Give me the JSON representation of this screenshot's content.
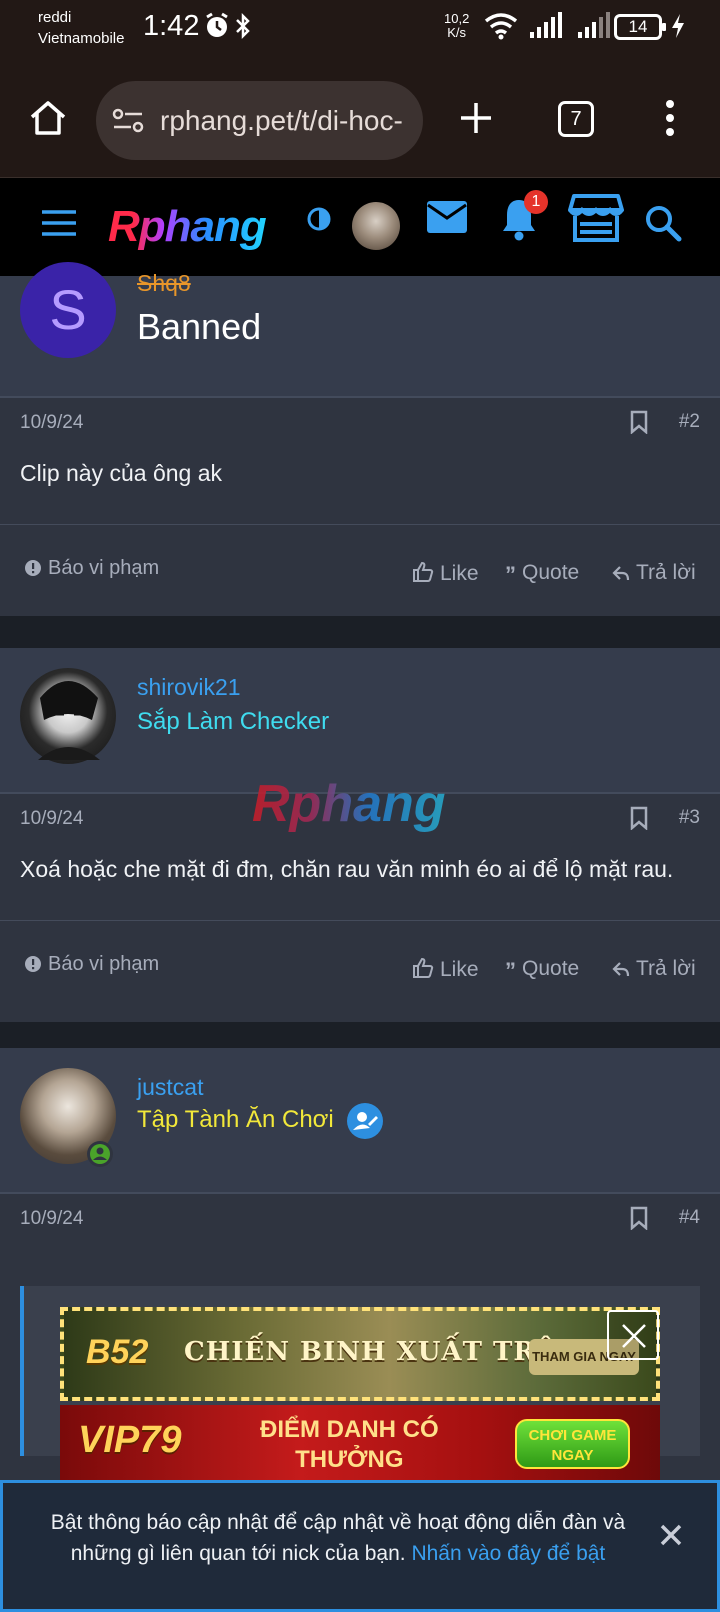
{
  "status": {
    "carrier_line1": "reddi",
    "carrier_line2": "Vietnamobile",
    "time": "1:42",
    "net_speed_value": "10,2",
    "net_speed_unit": "K/s",
    "battery": "14"
  },
  "browser": {
    "url": "rphang.pet/t/di-hoc-",
    "tab_count": "7"
  },
  "site": {
    "logo": "Rphang",
    "notification_count": "1",
    "watermark": "Rphang",
    "colors": {
      "accent": "#2d8fe0",
      "bg": "#1b1f26",
      "card": "#2f3440",
      "userrow": "#353c4c"
    }
  },
  "posts": [
    {
      "avatar_letter": "S",
      "username": "Shq8",
      "user_title": "Banned",
      "date": "10/9/24",
      "number": "#2",
      "text": "Clip này của ông ak",
      "report": "Báo vi phạm",
      "like": "Like",
      "quote": "Quote",
      "reply": "Trả lời"
    },
    {
      "username": "shirovik21",
      "user_title": "Sắp Làm Checker",
      "date": "10/9/24",
      "number": "#3",
      "text": "Xoá hoặc che mặt đi đm, chăn rau văn minh éo ai để lộ mặt rau.",
      "report": "Báo vi phạm",
      "like": "Like",
      "quote": "Quote",
      "reply": "Trả lời"
    },
    {
      "username": "justcat",
      "user_title": "Tập Tành Ăn Chơi",
      "date": "10/9/24",
      "number": "#4"
    }
  ],
  "ads": {
    "banner1_brand": "B52",
    "banner1_title": "CHIẾN BINH XUẤT TRẬN",
    "banner1_button": "THAM GIA NGAY",
    "banner2_brand": "VIP79",
    "banner2_title_line1": "ĐIỂM DANH CÓ",
    "banner2_title_line2": "THƯỞNG",
    "banner2_button_line1": "CHƠI GAME",
    "banner2_button_line2": "NGAY"
  },
  "notification_banner": {
    "text": "Bật thông báo cập nhật để cập nhật về hoạt động diễn đàn và những gì liên quan tới nick của bạn.",
    "link": "Nhấn vào đây để bật"
  }
}
